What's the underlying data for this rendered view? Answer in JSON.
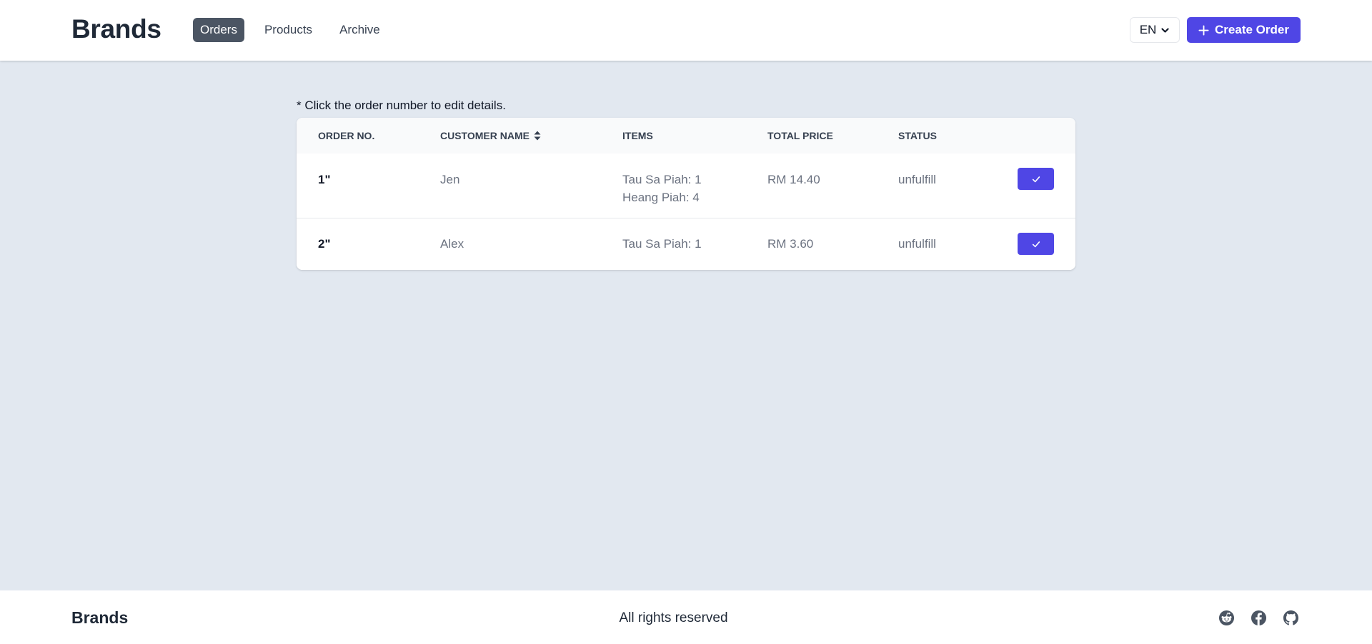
{
  "header": {
    "brand": "Brands",
    "nav": [
      {
        "label": "Orders",
        "active": true
      },
      {
        "label": "Products",
        "active": false
      },
      {
        "label": "Archive",
        "active": false
      }
    ],
    "language": "EN",
    "create_button_label": "Create Order"
  },
  "main": {
    "hint": "* Click the order number to edit details.",
    "table": {
      "columns": [
        "ORDER NO.",
        "CUSTOMER NAME",
        "ITEMS",
        "TOTAL PRICE",
        "STATUS"
      ],
      "rows": [
        {
          "order_no": "1\"",
          "customer": "Jen",
          "items": [
            "Tau Sa Piah: 1",
            "Heang Piah: 4"
          ],
          "total": "RM 14.40",
          "status": "unfulfill"
        },
        {
          "order_no": "2\"",
          "customer": "Alex",
          "items": [
            "Tau Sa Piah: 1"
          ],
          "total": "RM 3.60",
          "status": "unfulfill"
        }
      ]
    }
  },
  "footer": {
    "brand": "Brands",
    "text": "All rights reserved",
    "social": [
      "reddit-icon",
      "facebook-icon",
      "github-icon"
    ]
  },
  "colors": {
    "accent": "#4f46e5",
    "nav_active_bg": "#4b5563",
    "page_bg": "#e2e8f0"
  }
}
